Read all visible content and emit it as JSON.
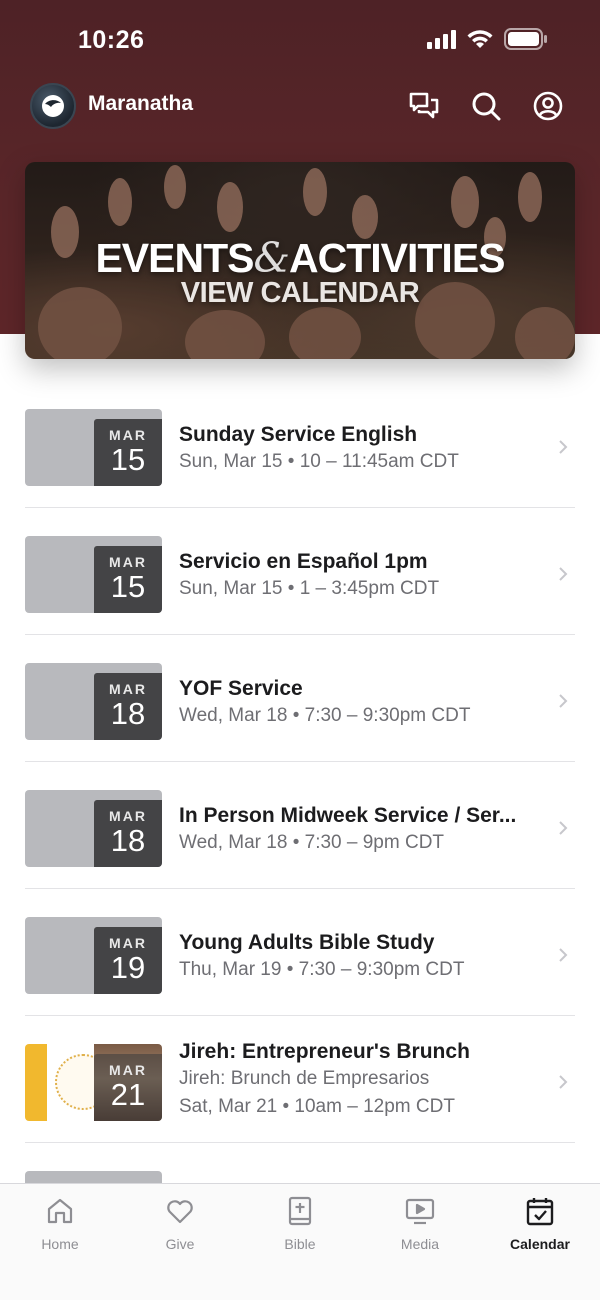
{
  "status_bar": {
    "time": "10:26"
  },
  "app_bar": {
    "title": "Maranatha"
  },
  "banner": {
    "title_left": "EVENTS",
    "title_amp": "&",
    "title_right": "ACTIVITIES",
    "subtitle": "VIEW CALENDAR"
  },
  "events": [
    {
      "month": "MAR",
      "day": "15",
      "title": "Sunday Service English",
      "subtitle": "Sun, Mar 15 • 10 – 11:45am CDT"
    },
    {
      "month": "MAR",
      "day": "15",
      "title": "Servicio en Español 1pm",
      "subtitle": "Sun, Mar 15 • 1 – 3:45pm CDT"
    },
    {
      "month": "MAR",
      "day": "18",
      "title": "YOF Service",
      "subtitle": "Wed, Mar 18 • 7:30 – 9:30pm CDT"
    },
    {
      "month": "MAR",
      "day": "18",
      "title": "In Person Midweek Service / Ser...",
      "subtitle": "Wed, Mar 18 • 7:30 – 9pm CDT"
    },
    {
      "month": "MAR",
      "day": "19",
      "title": "Young Adults Bible Study",
      "subtitle": "Thu, Mar 19 • 7:30 – 9:30pm CDT"
    },
    {
      "month": "MAR",
      "day": "21",
      "title": "Jireh: Entrepreneur's Brunch",
      "subtitle": "Jireh: Brunch de Empresarios",
      "detail": "Sat, Mar 21 • 10am – 12pm CDT"
    }
  ],
  "tabs": [
    {
      "label": "Home",
      "icon": "home-icon"
    },
    {
      "label": "Give",
      "icon": "heart-icon"
    },
    {
      "label": "Bible",
      "icon": "bible-icon"
    },
    {
      "label": "Media",
      "icon": "media-icon"
    },
    {
      "label": "Calendar",
      "icon": "calendar-icon",
      "active": true
    }
  ],
  "colors": {
    "header": "#5a2629",
    "date_box": "#3a3a3c",
    "thumb": "#b8b9bd",
    "active_tab": "#1c1c1e",
    "inactive_tab": "#8e8e93"
  }
}
